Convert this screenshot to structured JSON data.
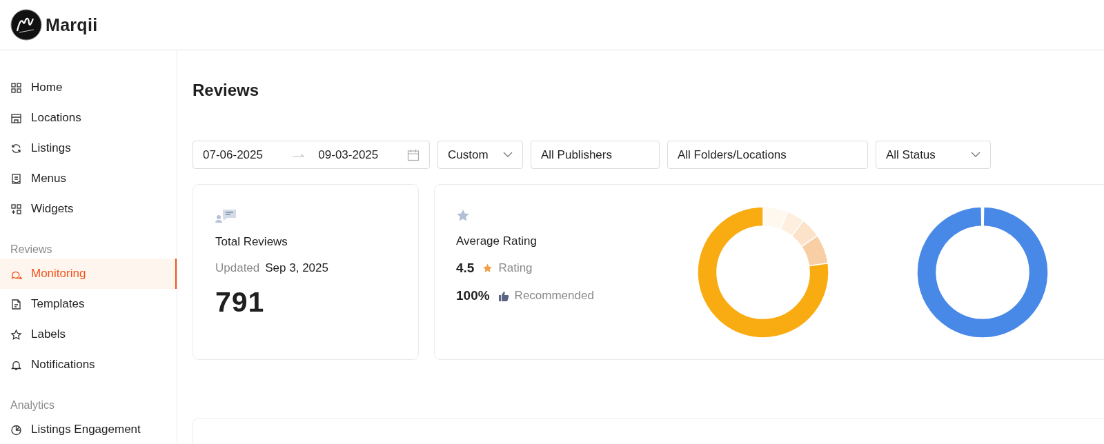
{
  "brand": {
    "name": "Marqii"
  },
  "sidebar": {
    "sections": [
      {
        "items": [
          {
            "label": "Home",
            "selected": false
          },
          {
            "label": "Locations",
            "selected": false
          },
          {
            "label": "Listings",
            "selected": false
          },
          {
            "label": "Menus",
            "selected": false
          },
          {
            "label": "Widgets",
            "selected": false
          }
        ]
      },
      {
        "heading": "Reviews",
        "items": [
          {
            "label": "Monitoring",
            "selected": true
          },
          {
            "label": "Templates",
            "selected": false
          },
          {
            "label": "Labels",
            "selected": false
          },
          {
            "label": "Notifications",
            "selected": false
          }
        ]
      },
      {
        "heading": "Analytics",
        "items": [
          {
            "label": "Listings Engagement",
            "selected": false
          }
        ]
      }
    ]
  },
  "page": {
    "title": "Reviews"
  },
  "filters": {
    "date_range": {
      "start": "07-06-2025",
      "end": "09-03-2025"
    },
    "selects": [
      {
        "value": "Custom",
        "kind": "dropdown"
      },
      {
        "value": "All Publishers",
        "kind": "plain"
      },
      {
        "value": "All Folders/Locations",
        "kind": "plain"
      },
      {
        "value": "All Status",
        "kind": "dropdown"
      }
    ]
  },
  "total_reviews": {
    "title": "Total Reviews",
    "updated_label": "Updated",
    "updated_date": "Sep 3, 2025",
    "count": "791"
  },
  "average_rating": {
    "title": "Average Rating",
    "rating": "4.5",
    "rating_label": "Rating",
    "recommended": "100%",
    "recommended_label": "Recommended"
  }
}
